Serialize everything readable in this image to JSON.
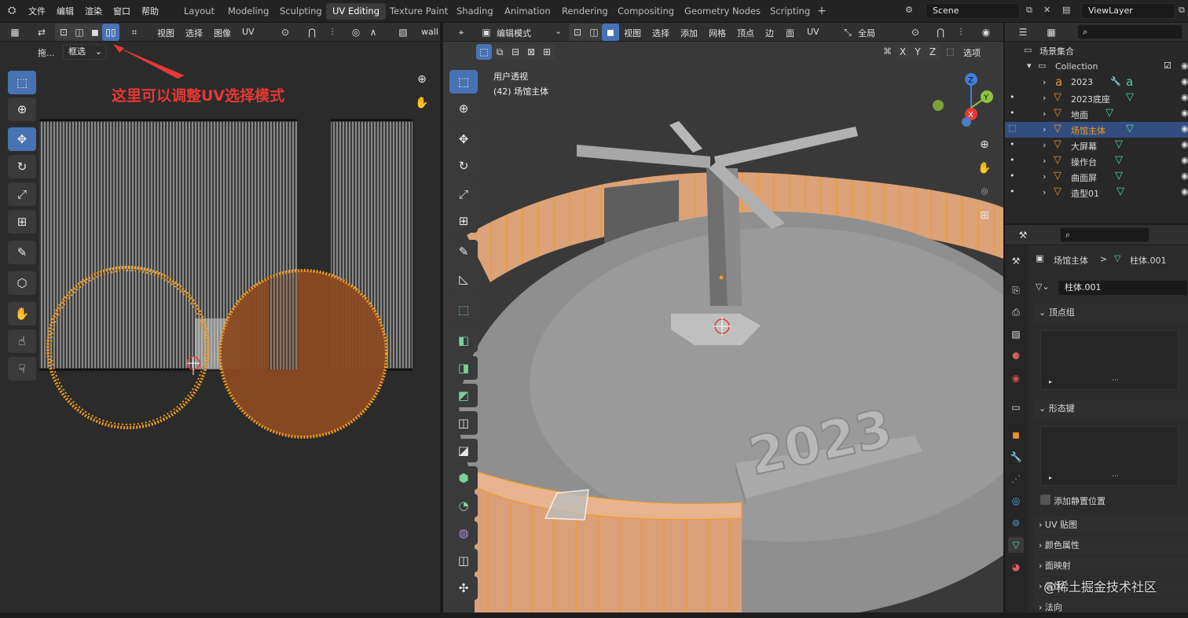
{
  "topbar": {
    "menus": [
      "文件",
      "编辑",
      "渲染",
      "窗口",
      "帮助"
    ],
    "workspaces": [
      "Layout",
      "Modeling",
      "Sculpting",
      "UV Editing",
      "Texture Paint",
      "Shading",
      "Animation",
      "Rendering",
      "Compositing",
      "Geometry Nodes",
      "Scripting"
    ],
    "active_workspace": "UV Editing",
    "add_tab": "+",
    "scene_label": "Scene",
    "viewlayer_label": "ViewLayer"
  },
  "uv_editor": {
    "menus": [
      "视图",
      "选择",
      "图像",
      "UV"
    ],
    "image_name": "wall",
    "drag_label": "拖...",
    "select_mode": "框选",
    "annotation": "这里可以调整UV选择模式",
    "tools": [
      "select-box",
      "cursor",
      "move",
      "rotate",
      "scale",
      "transform",
      "annotate",
      "rip",
      "grab",
      "relax",
      "pinch"
    ]
  },
  "viewport": {
    "mode": "编辑模式",
    "menus": [
      "视图",
      "选择",
      "添加",
      "网格",
      "顶点",
      "边",
      "面",
      "UV"
    ],
    "orientation": "全局",
    "view_name": "用户透视",
    "object_info": "(42) 场馆主体",
    "axes": [
      "X",
      "Y",
      "Z"
    ],
    "options": "选项",
    "gizmo_labels": {
      "z": "Z",
      "y": "Y",
      "x": "X"
    },
    "text_object": "2023"
  },
  "outliner": {
    "scene_collection": "场景集合",
    "collection": "Collection",
    "items": [
      {
        "name": "2023",
        "selected": false
      },
      {
        "name": "2023底座",
        "selected": false
      },
      {
        "name": "地面",
        "selected": false
      },
      {
        "name": "场馆主体",
        "selected": true
      },
      {
        "name": "大屏幕",
        "selected": false
      },
      {
        "name": "操作台",
        "selected": false
      },
      {
        "name": "曲面屏",
        "selected": false
      },
      {
        "name": "造型01",
        "selected": false
      }
    ]
  },
  "properties": {
    "breadcrumb_object": "场馆主体",
    "breadcrumb_sep": ">",
    "breadcrumb_data": "柱体.001",
    "mesh_name": "柱体.001",
    "sections": {
      "vertex_groups": "顶点组",
      "shape_keys": "形态键",
      "rest_position": "添加静置位置",
      "uv_maps": "UV 贴图",
      "color_attributes": "颜色属性",
      "face_maps": "面映射",
      "attributes": "属性",
      "normals": "法向"
    }
  },
  "watermark": "@稀土掘金技术社区",
  "colors": {
    "accent": "#4772b3",
    "selection_orange": "#e8913a",
    "annotation_red": "#e53935",
    "mesh_green": "#58d49b"
  }
}
